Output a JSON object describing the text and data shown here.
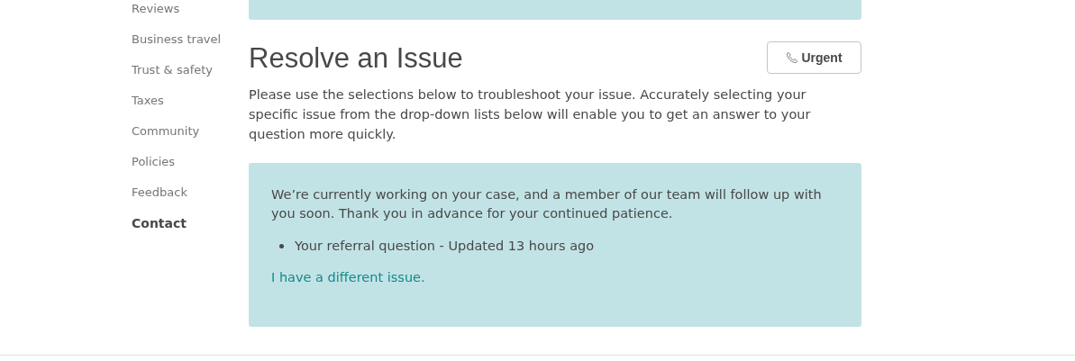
{
  "sidebar": {
    "items": [
      {
        "label": "Reviews",
        "selected": false
      },
      {
        "label": "Business travel",
        "selected": false
      },
      {
        "label": "Trust & safety",
        "selected": false
      },
      {
        "label": "Taxes",
        "selected": false
      },
      {
        "label": "Community",
        "selected": false
      },
      {
        "label": "Policies",
        "selected": false
      },
      {
        "label": "Feedback",
        "selected": false
      },
      {
        "label": "Contact",
        "selected": true
      }
    ]
  },
  "main": {
    "title": "Resolve an Issue",
    "urgent_button": "Urgent",
    "intro": "Please use the selections below to troubleshoot your issue. Accurately selecting your specific issue from the drop-down lists below will enable you to get an answer to your question more quickly.",
    "status": {
      "message": "We’re currently working on your case, and a member of our team will follow up with you soon. Thank you in advance for your continued patience.",
      "cases": [
        "Your referral question - Updated 13 hours ago"
      ],
      "link": "I have a different issue."
    }
  }
}
